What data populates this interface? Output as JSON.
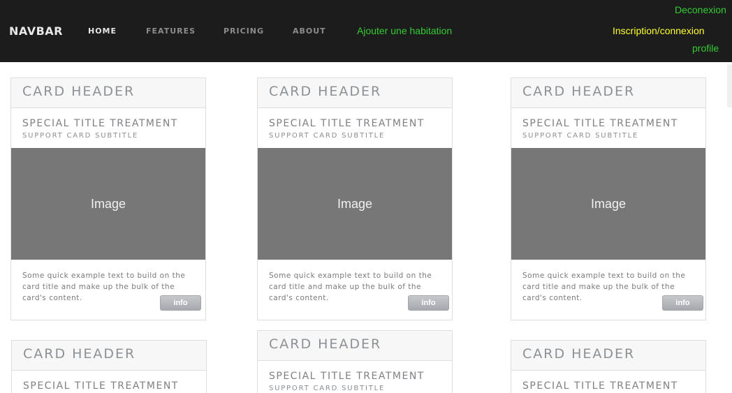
{
  "navbar": {
    "brand": "NAVBAR",
    "links": [
      {
        "label": "HOME"
      },
      {
        "label": "FEATURES"
      },
      {
        "label": "PRICING"
      },
      {
        "label": "ABOUT"
      }
    ],
    "add_habitation": "Ajouter une habitation",
    "deconnexion": "Deconexion",
    "inscription": "Inscription/connexion",
    "profile": "profile",
    "colors": {
      "green": "#33cc33",
      "yellow": "#ffff33",
      "background": "#1c1c1c"
    }
  },
  "cards": [
    {
      "header": "CARD HEADER",
      "title": "SPECIAL TITLE TREATMENT",
      "subtitle": "SUPPORT CARD SUBTITLE",
      "image": "Image",
      "text": "Some quick example text to build on the card title and make up the bulk of the card's content.",
      "button": "info"
    },
    {
      "header": "CARD HEADER",
      "title": "SPECIAL TITLE TREATMENT",
      "subtitle": "SUPPORT CARD SUBTITLE",
      "image": "Image",
      "text": "Some quick example text to build on the card title and make up the bulk of the card's content.",
      "button": "info"
    },
    {
      "header": "CARD HEADER",
      "title": "SPECIAL TITLE TREATMENT",
      "subtitle": "SUPPORT CARD SUBTITLE",
      "image": "Image",
      "text": "Some quick example text to build on the card title and make up the bulk of the card's content.",
      "button": "info"
    },
    {
      "header": "CARD HEADER",
      "title": "SPECIAL TITLE TREATMENT"
    },
    {
      "header": "CARD HEADER",
      "title": "SPECIAL TITLE TREATMENT",
      "subtitle": "SUPPORT CARD SUBTITLE"
    },
    {
      "header": "CARD HEADER",
      "title": "SPECIAL TITLE TREATMENT"
    }
  ]
}
